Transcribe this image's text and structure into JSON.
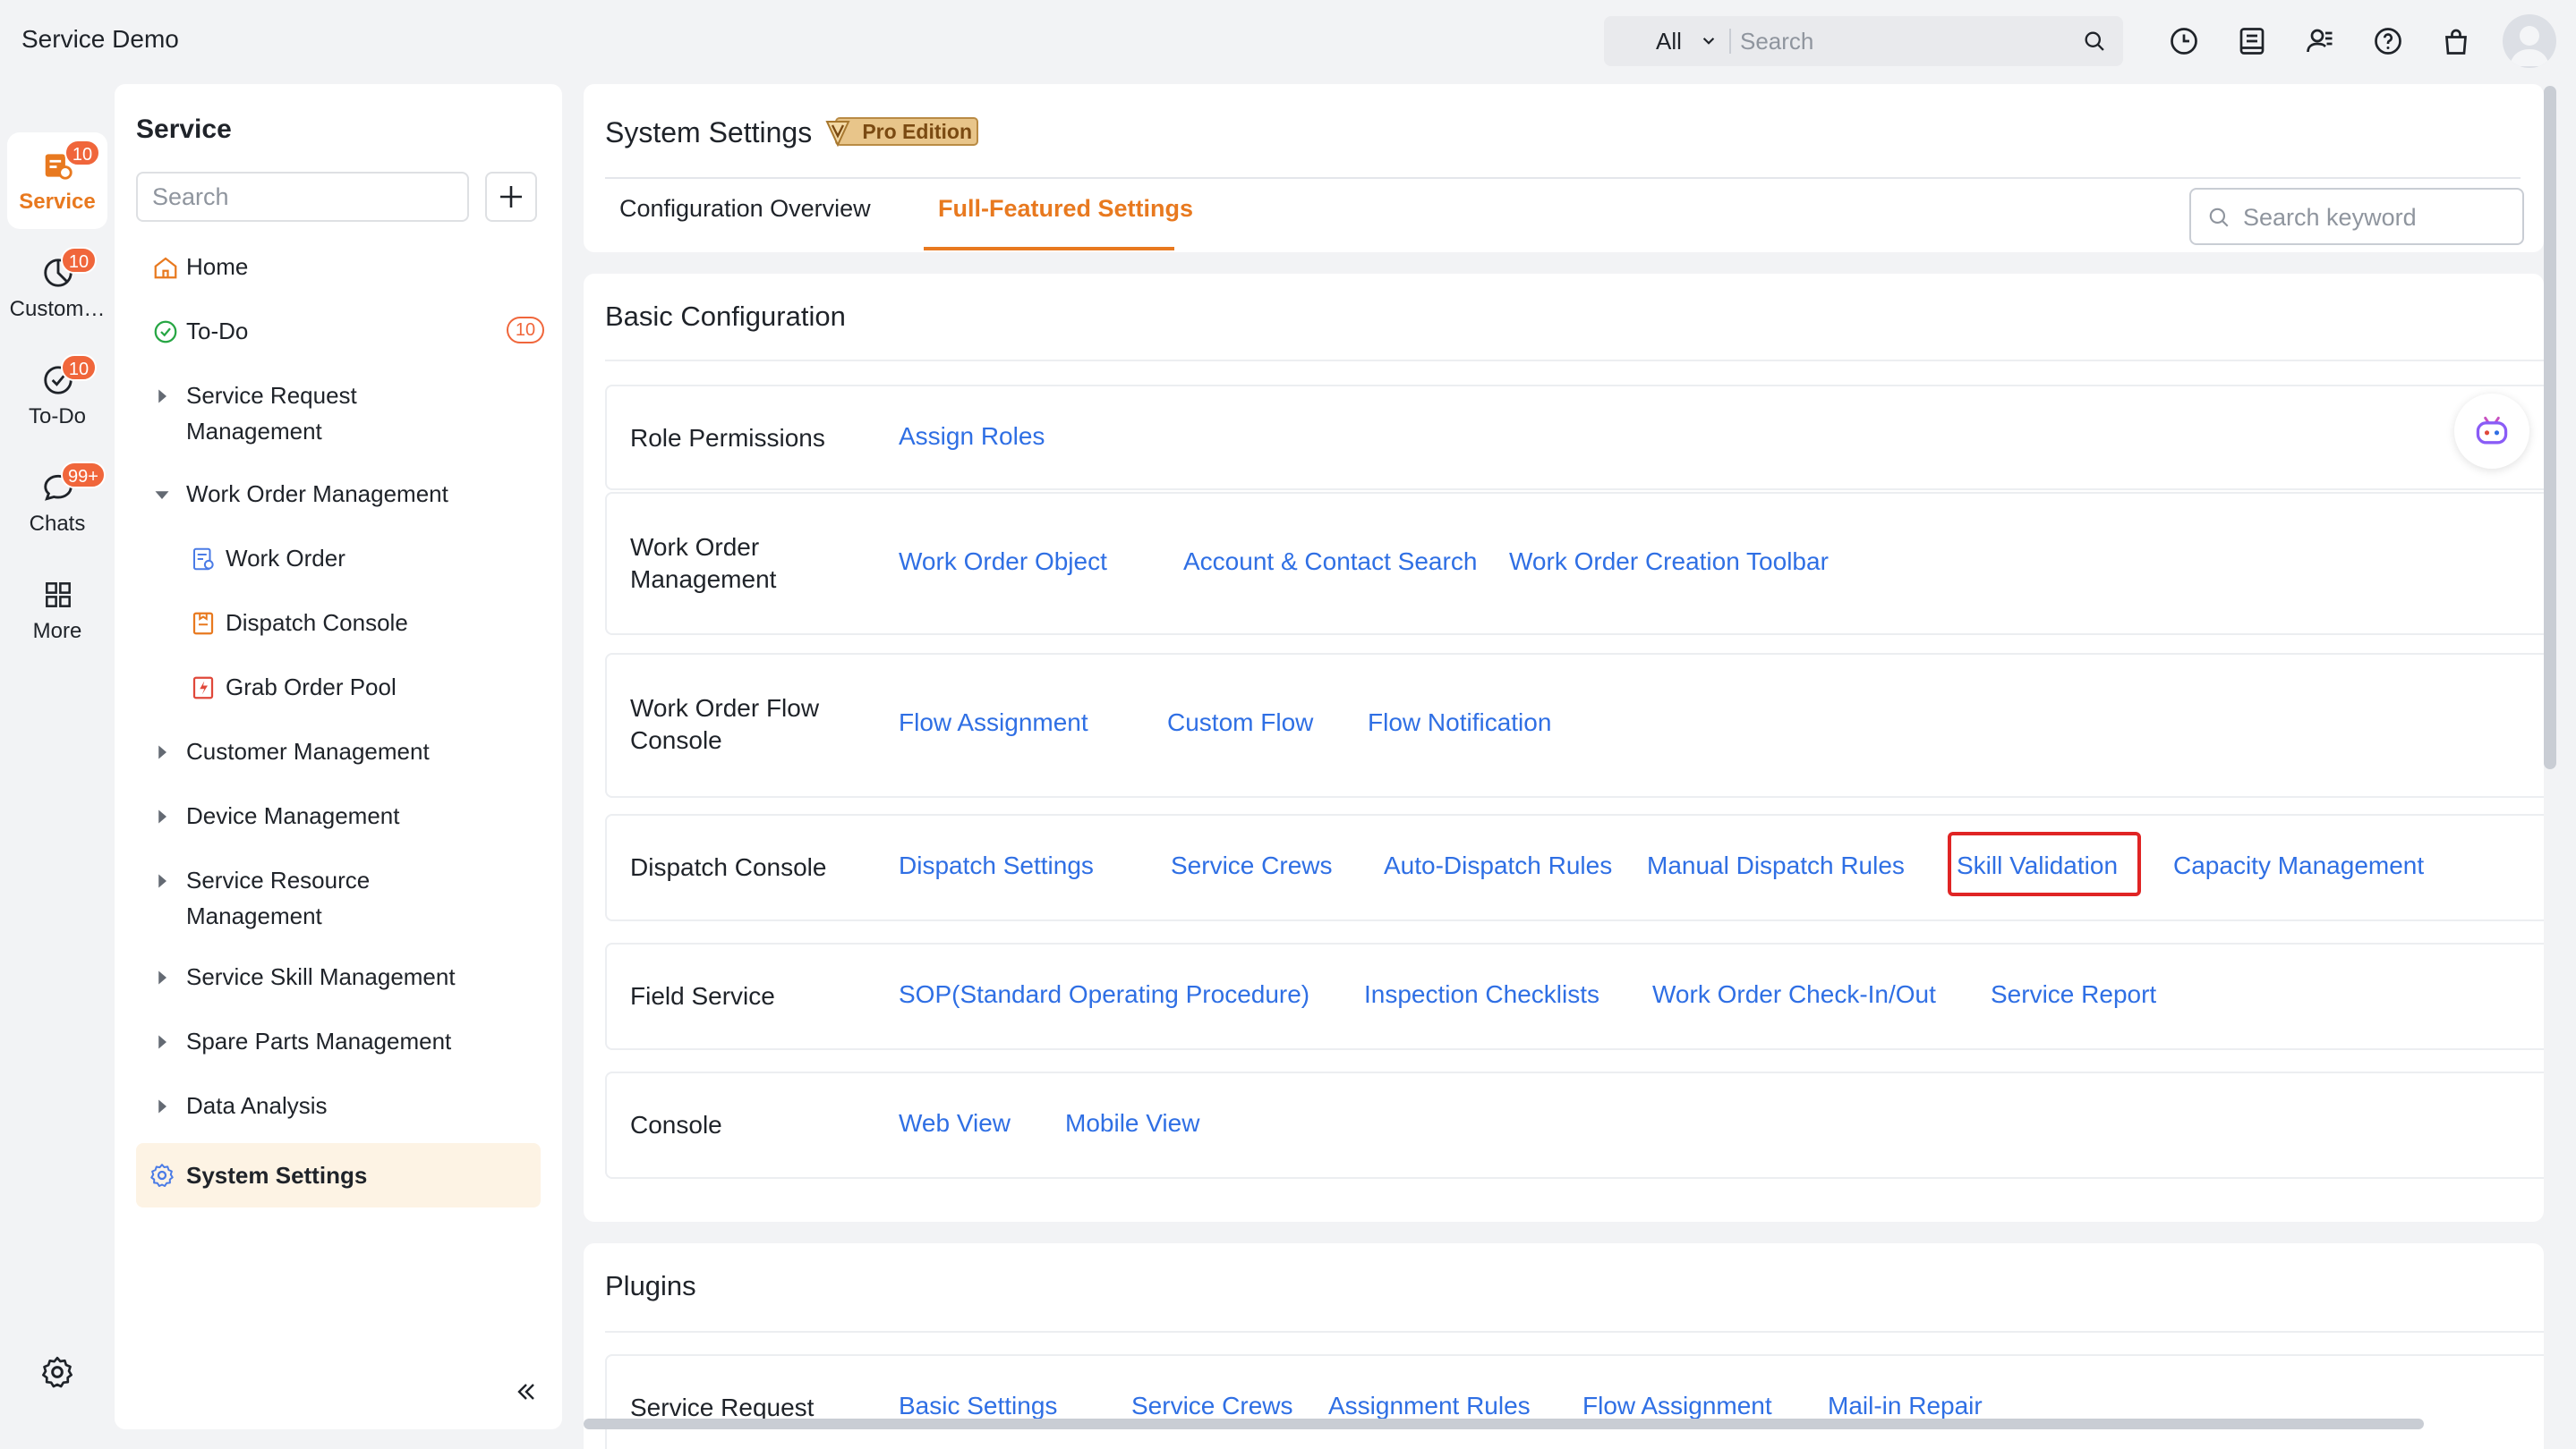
{
  "app": {
    "title": "Service Demo"
  },
  "topbar": {
    "search_scope": "All",
    "search_placeholder": "Search",
    "icons": [
      "clock-icon",
      "notes-icon",
      "contacts-icon",
      "help-icon",
      "bag-icon",
      "user-avatar"
    ]
  },
  "rail": {
    "items": [
      {
        "label": "Service",
        "badge": "10",
        "icon": "service-icon",
        "active": true
      },
      {
        "label": "Custom…",
        "badge": "10",
        "icon": "pie-chart-icon",
        "active": false
      },
      {
        "label": "To-Do",
        "badge": "10",
        "icon": "check-circle-icon",
        "active": false
      },
      {
        "label": "Chats",
        "badge": "99+",
        "icon": "chat-bubble-icon",
        "active": false
      },
      {
        "label": "More",
        "badge": "",
        "icon": "grid-icon",
        "active": false
      }
    ],
    "settings_icon": "gear-icon"
  },
  "nav": {
    "title": "Service",
    "search_placeholder": "Search",
    "todo_badge": "10",
    "items": [
      {
        "label": "Home",
        "icon": "home-icon"
      },
      {
        "label": "To-Do",
        "icon": "check-circle-icon"
      },
      {
        "label": "Service Request Management",
        "icon": "caret-right-icon"
      },
      {
        "label": "Work Order Management",
        "icon": "caret-down-icon"
      },
      {
        "label": "Work Order",
        "icon": "work-order-icon"
      },
      {
        "label": "Dispatch Console",
        "icon": "dispatch-icon"
      },
      {
        "label": "Grab Order Pool",
        "icon": "grab-pool-icon"
      },
      {
        "label": "Customer Management",
        "icon": "caret-right-icon"
      },
      {
        "label": "Device Management",
        "icon": "caret-right-icon"
      },
      {
        "label": "Service Resource Management",
        "icon": "caret-right-icon"
      },
      {
        "label": "Service Skill Management",
        "icon": "caret-right-icon"
      },
      {
        "label": "Spare Parts Management",
        "icon": "caret-right-icon"
      },
      {
        "label": "Data Analysis",
        "icon": "caret-right-icon"
      },
      {
        "label": "System Settings",
        "icon": "gear-icon"
      }
    ]
  },
  "main": {
    "title": "System Settings",
    "edition_badge": "Pro Edition",
    "tabs": [
      {
        "label": "Configuration Overview",
        "active": false
      },
      {
        "label": "Full-Featured Settings",
        "active": true
      }
    ],
    "keyword_placeholder": "Search keyword",
    "basic": {
      "title": "Basic Configuration",
      "rows": [
        {
          "label": "Role Permissions",
          "links": [
            "Assign Roles"
          ]
        },
        {
          "label": "Work Order Management",
          "links": [
            "Work Order Object",
            "Account & Contact Search",
            "Work Order Creation Toolbar"
          ]
        },
        {
          "label": "Work Order Flow Console",
          "links": [
            "Flow Assignment",
            "Custom Flow",
            "Flow Notification"
          ]
        },
        {
          "label": "Dispatch Console",
          "links": [
            "Dispatch Settings",
            "Service Crews",
            "Auto-Dispatch Rules",
            "Manual Dispatch Rules",
            "Skill Validation",
            "Capacity Management"
          ]
        },
        {
          "label": "Field Service",
          "links": [
            "SOP(Standard Operating Procedure)",
            "Inspection Checklists",
            "Work Order Check-In/Out",
            "Service Report"
          ]
        },
        {
          "label": "Console",
          "links": [
            "Web View",
            "Mobile View"
          ]
        }
      ]
    },
    "plugins": {
      "title": "Plugins",
      "rows": [
        {
          "label": "Service Request",
          "links": [
            "Basic Settings",
            "Service Crews",
            "Assignment Rules",
            "Flow Assignment",
            "Mail-in Repair"
          ]
        }
      ]
    }
  },
  "colors": {
    "accent": "#e8791f",
    "link": "#2f6fe4",
    "badge": "#f0663b",
    "highlight": "#e02424"
  }
}
